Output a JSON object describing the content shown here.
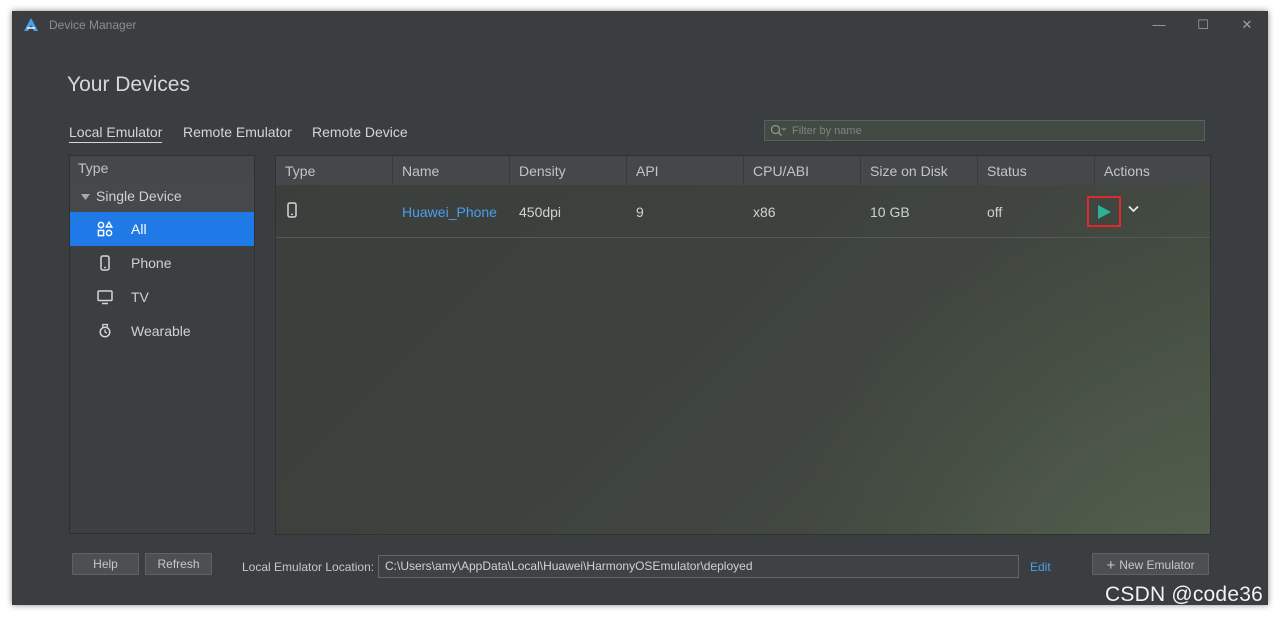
{
  "window": {
    "title": "Device Manager",
    "controls": {
      "minimize": "—",
      "maximize": "☐",
      "close": "✕"
    }
  },
  "heading": "Your Devices",
  "tabs": [
    {
      "label": "Local Emulator",
      "active": true
    },
    {
      "label": "Remote Emulator",
      "active": false
    },
    {
      "label": "Remote Device",
      "active": false
    }
  ],
  "filter": {
    "placeholder": "Filter by name",
    "value": ""
  },
  "sidebar": {
    "header": "Type",
    "group": "Single Device",
    "items": [
      {
        "label": "All",
        "icon": "all-categories-icon",
        "selected": true
      },
      {
        "label": "Phone",
        "icon": "phone-icon",
        "selected": false
      },
      {
        "label": "TV",
        "icon": "tv-icon",
        "selected": false
      },
      {
        "label": "Wearable",
        "icon": "watch-icon",
        "selected": false
      }
    ]
  },
  "table": {
    "columns": [
      "Type",
      "Name",
      "Density",
      "API",
      "CPU/ABI",
      "Size on Disk",
      "Status",
      "Actions"
    ],
    "rows": [
      {
        "type_icon": "phone-icon",
        "name": "Huawei_Phone",
        "density": "450dpi",
        "api": "9",
        "cpu": "x86",
        "size": "10 GB",
        "status": "off"
      }
    ]
  },
  "footer": {
    "help": "Help",
    "refresh": "Refresh",
    "location_label": "Local Emulator Location:",
    "location_value": "C:\\Users\\amy\\AppData\\Local\\Huawei\\HarmonyOSEmulator\\deployed",
    "edit": "Edit",
    "new_emulator": "New Emulator"
  },
  "watermark": "CSDN @code36",
  "colors": {
    "accent": "#1f7ae8",
    "link": "#4a9ef0",
    "play": "#2bb39a",
    "highlight_border": "#e0272c",
    "window_bg": "#3b3e40"
  }
}
